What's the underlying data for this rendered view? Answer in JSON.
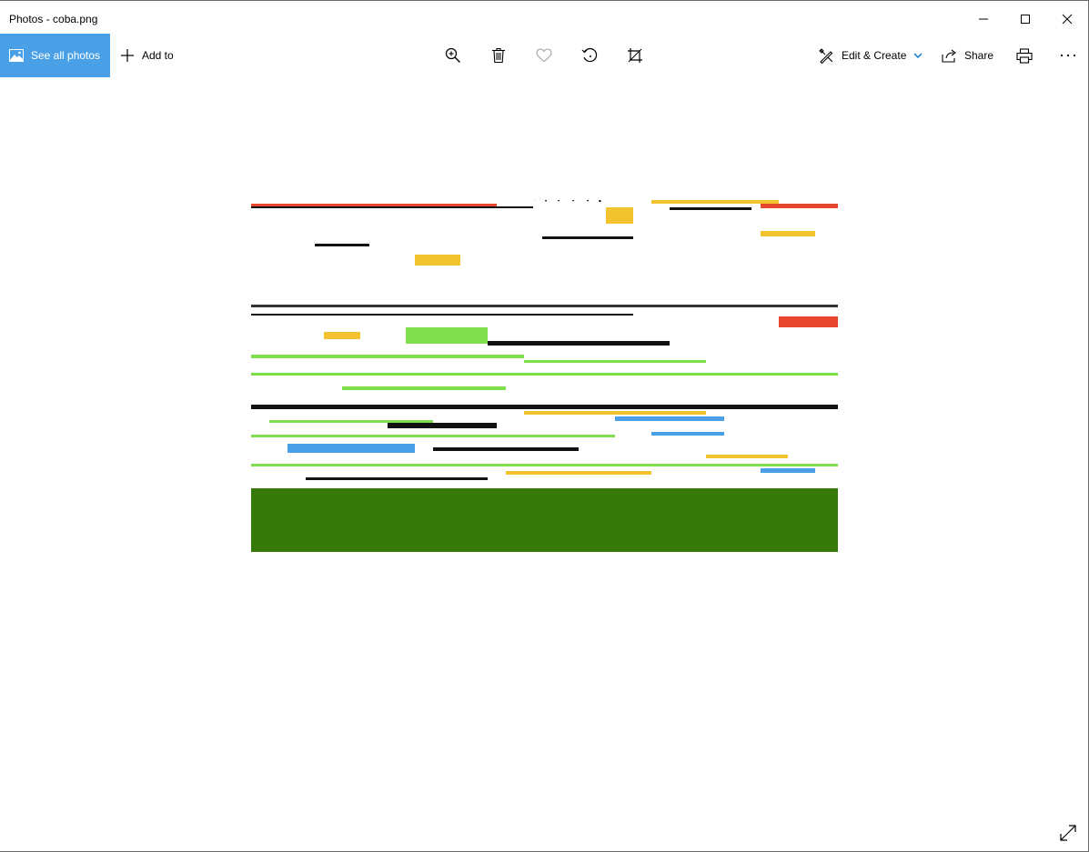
{
  "window": {
    "title": "Photos - coba.png"
  },
  "toolbar": {
    "see_all_label": "See all photos",
    "add_to_label": "Add to",
    "edit_create_label": "Edit & Create",
    "share_label": "Share",
    "icons": {
      "see_all": "image-icon",
      "add_to": "plus-icon",
      "zoom": "zoom-in-icon",
      "delete": "trash-icon",
      "favorite": "heart-icon",
      "rotate": "rotate-icon",
      "crop": "crop-icon",
      "edit_create": "edit-create-icon",
      "edit_dropdown": "chevron-down-icon",
      "share": "share-icon",
      "print": "print-icon",
      "more": "more-icon"
    }
  },
  "viewer": {
    "expand_icon": "expand-icon"
  },
  "colors": {
    "accent": "#4aa0e6",
    "dropdown_chevron": "#0078d7",
    "photo_ground": "#367a0a"
  }
}
